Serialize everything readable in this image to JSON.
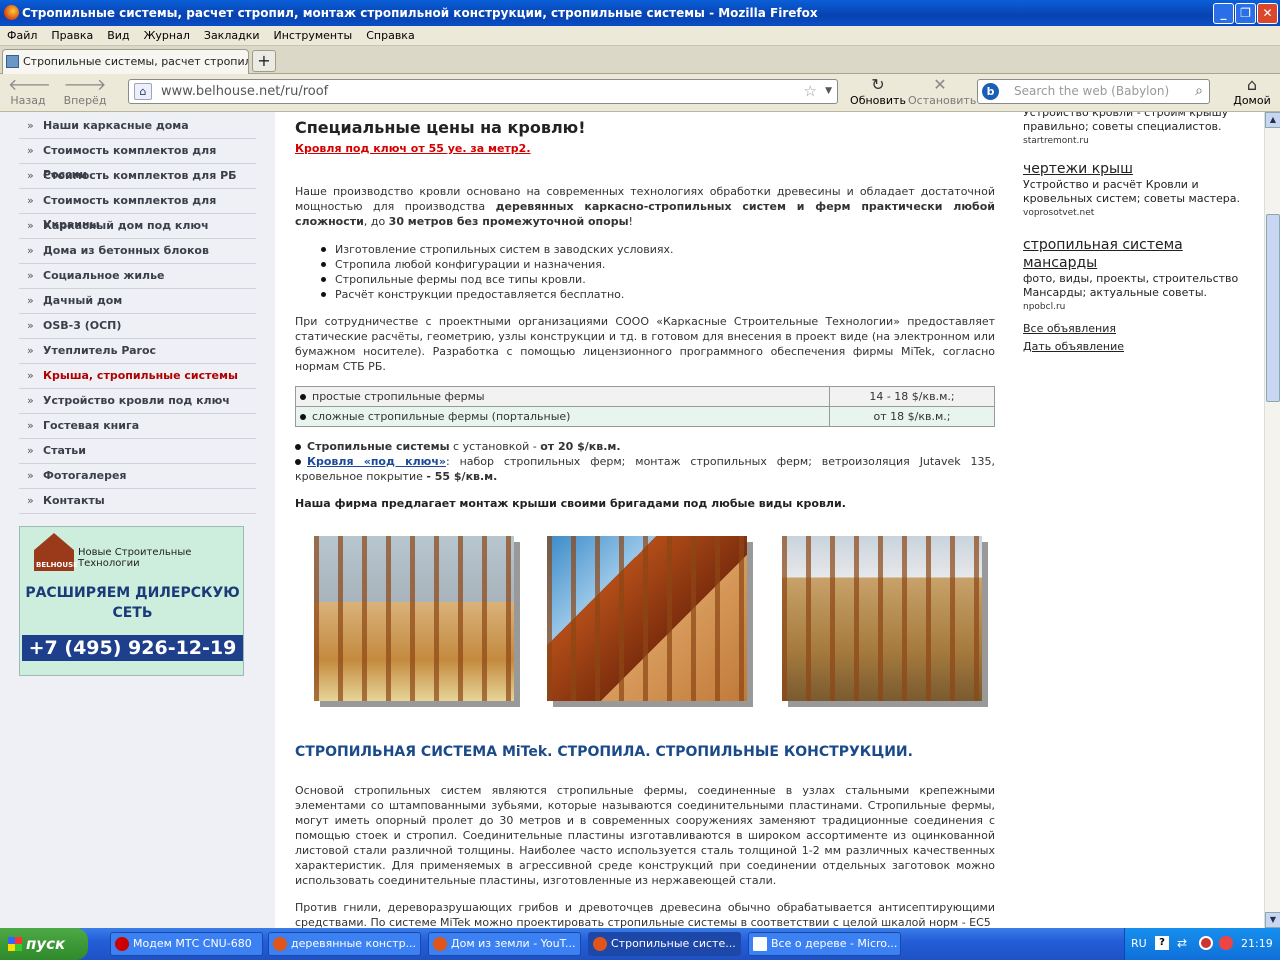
{
  "window": {
    "title": "Стропильные системы, расчет стропил, монтаж стропильной конструкции, стропильные системы - Mozilla Firefox",
    "min": "_",
    "max": "❐",
    "close": "✕"
  },
  "menu": [
    "Файл",
    "Правка",
    "Вид",
    "Журнал",
    "Закладки",
    "Инструменты",
    "Справка"
  ],
  "tab": {
    "title": "Стропильные системы, расчет стропил, м...",
    "new_tab": "+"
  },
  "toolbar": {
    "back": "Назад",
    "forward": "Вперёд",
    "reload": "Обновить",
    "stop": "Остановить",
    "home": "Домой",
    "url": "www.belhouse.net/ru/roof",
    "search_placeholder": "Search the web (Babylon)"
  },
  "sidebar": {
    "items": [
      "Наши каркасные дома",
      "Стоимость комплектов для России",
      "Стоимость комплектов для РБ",
      "Стоимость комплектов для Украины",
      "Каркасный дом под ключ",
      "Дома из бетонных блоков",
      "Социальное жилье",
      "Дачный дом",
      "OSB-3 (ОСП)",
      "Утеплитель Paroc",
      "Крыша, стропильные системы",
      "Устройство кровли под ключ",
      "Гостевая книга",
      "Статьи",
      "Фотогалерея",
      "Контакты"
    ],
    "active_index": 10,
    "banner": {
      "logo": "BELHOUSE",
      "company": "Новые Строительные Технологии",
      "headline": "РАСШИРЯЕМ ДИЛЕРСКУЮ СЕТЬ",
      "phone": "+7 (495) 926-12-19"
    }
  },
  "main": {
    "heading": "Специальные цены на кровлю!",
    "promo": "Кровля под ключ от 55 уе. за метр2.",
    "intro_a": "Наше производство кровли основано на современных технологиях обработки древесины и обладает достаточной мощностью для производства ",
    "intro_b": "деревянных каркасно-стропильных систем и ферм практически любой сложности",
    "intro_c": ", до ",
    "intro_d": "30 метров без промежуточной опоры",
    "intro_e": "!",
    "bullets": [
      "Изготовление стропильных систем в заводских условиях.",
      "Стропила любой конфигурации и назначения.",
      "Стропильные фермы под все типы кровли.",
      "Расчёт конструкции предоставляется бесплатно."
    ],
    "coop": "При сотрудничестве с проектными организациями СООО «Каркасные Строительные Технологии» предоставляет статические расчёты, геометрию, узлы конструкции и тд. в готовом для внесения в проект виде (на электронном или бумажном носителе). Разработка с помощью лицензионного программного обеспечения фирмы MiTek, согласно нормам СТБ РБ.",
    "prices": [
      {
        "name": "простые стропильные фермы",
        "price": "14 - 18 $/кв.м.;"
      },
      {
        "name": "сложные стропильные фермы (портальные)",
        "price": "от 18 $/кв.м.;"
      }
    ],
    "line1_a": "Стропильные системы",
    "line1_b": " с установкой - ",
    "line1_c": "от 20 $/кв.м.",
    "line2_link": "Кровля «под ключ»",
    "line2_text": ": набор стропильных ферм; монтаж стропильных ферм; ветроизоляция Jutavek 135, кровельное покрытие ",
    "line2_price": " - 55 $/кв.м.",
    "offer": "Наша фирма предлагает монтаж крыши своими бригадами под любые виды кровли.",
    "section_title": "СТРОПИЛЬНАЯ СИСТЕМА MiTek. СТРОПИЛА. СТРОПИЛЬНЫЕ КОНСТРУКЦИИ.",
    "body1": "Основой стропильных систем являются стропильные фермы, соединенные в узлах стальными крепежными элементами со штампованными зубьями, которые называются соединительными пластинами. Стропильные фермы, могут иметь опорный пролет до 30 метров и в современных сооружениях заменяют традиционные соединения с помощью стоек и стропил. Соединительные пластины изготавливаются в широком ассортименте из оцинкованной листовой стали различной толщины. Наиболее часто используется сталь толщиной 1-2 мм различных качественных характеристик. Для применяемых в агрессивной среде конструкций при соединении отдельных заготовок можно использовать соединительные пластины, изготовленные из нержавеющей стали.",
    "body2": "Против гнили, дереворазрушающих грибов и древоточцев древесина обычно обрабатывается антисептирующими средствами. По системе MiTek можно проектировать стропильные системы в соответствии с целой шкалой норм - EC5"
  },
  "ads": [
    {
      "title": "",
      "text": "Устройство кровли - строим крышу правильно; советы специалистов.",
      "domain": "startremont.ru"
    },
    {
      "title": "чертежи крыш",
      "text": "Устройство и расчёт Кровли и кровельных систем; советы мастера.",
      "domain": "voprosotvet.net"
    },
    {
      "title": "стропильная система мансарды",
      "text": "фото, виды, проекты, строительство Мансарды; актуальные советы.",
      "domain": "npobcl.ru"
    }
  ],
  "ad_links": [
    "Все объявления",
    "Дать объявление"
  ],
  "taskbar": {
    "start": "пуск",
    "tasks": [
      "Модем МТС CNU-680",
      "деревянные констр...",
      "Дом из земли - YouT...",
      "Стропильные систе...",
      "Все о дереве - Micro..."
    ],
    "active_task": 3,
    "lang": "RU",
    "help": "?",
    "clock": "21:19"
  }
}
